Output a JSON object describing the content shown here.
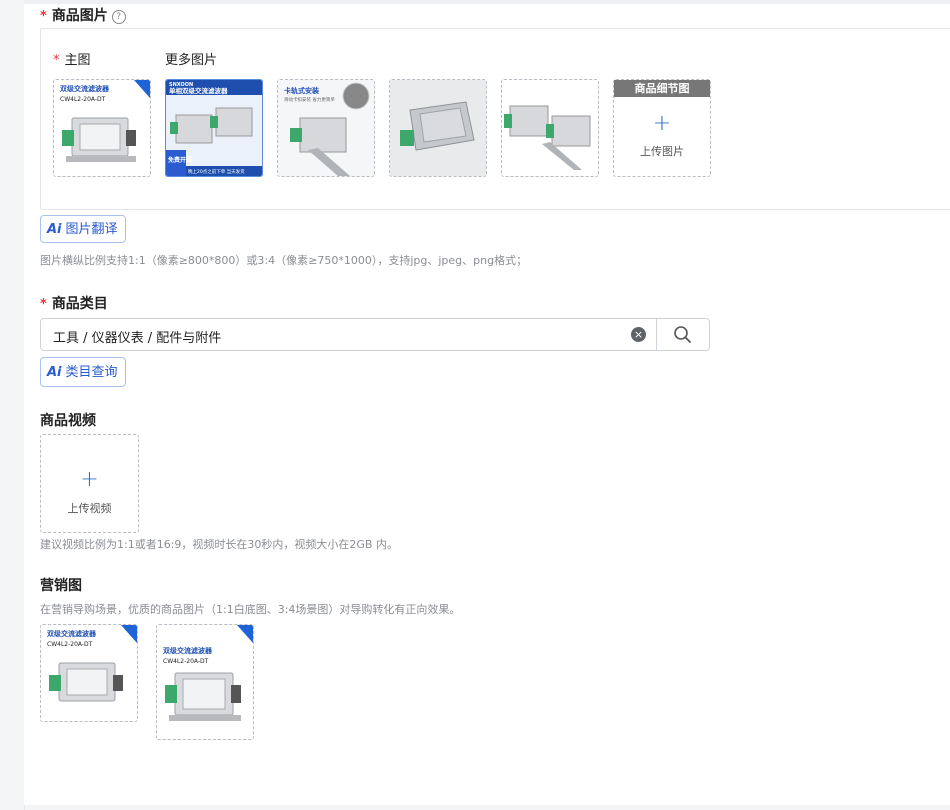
{
  "product_images": {
    "label": "商品图片",
    "required": "*",
    "help_icon": "?",
    "main_label": "主图",
    "more_label": "更多图片",
    "detail_header": "商品细节图",
    "upload_plus": "+",
    "upload_text": "上传图片",
    "thumbs": [
      {
        "banner": "双级交流滤波器",
        "model": "CW4L2-20A-DT"
      },
      {
        "banner": "单相双级交流滤波器",
        "brand": "SNXOON",
        "badge": "免费开票",
        "footer": "晚上20点之前下单 当天发货"
      },
      {
        "banner": "卡轨式安装",
        "sub": "滑动卡扣安装 省力更简单"
      },
      {},
      {}
    ],
    "ai_button": {
      "ai": "Ai",
      "label": "图片翻译"
    },
    "hint": "图片横纵比例支持1:1（像素≥800*800）或3:4（像素≥750*1000），支持jpg、jpeg、png格式；"
  },
  "category": {
    "label": "商品类目",
    "required": "*",
    "value": "工具 / 仪器仪表 / 配件与附件",
    "clear_icon": "×",
    "ai_button": {
      "ai": "Ai",
      "label": "类目查询"
    }
  },
  "video": {
    "label": "商品视频",
    "upload_plus": "+",
    "upload_text": "上传视频",
    "hint": "建议视频比例为1:1或者16:9，视频时长在30秒内，视频大小在2GB 内。"
  },
  "marketing": {
    "label": "营销图",
    "hint": "在营销导购场景，优质的商品图片（1:1白底图、3:4场景图）对导购转化有正向效果。",
    "thumbs": [
      {
        "banner": "双级交流滤波器",
        "model": "CW4L2-20A-DT"
      },
      {
        "banner": "双级交流滤波器",
        "model": "CW4L2-20A-DT"
      }
    ]
  }
}
